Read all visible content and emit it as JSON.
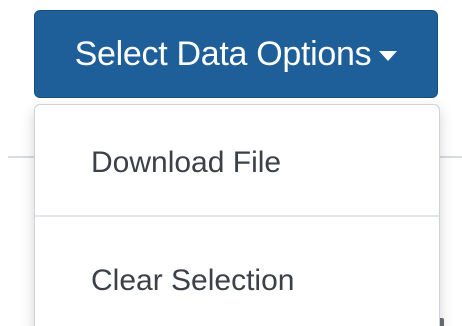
{
  "dropdown": {
    "toggle_label": "Select Data Options",
    "accent_color": "#1f5f99",
    "caret_icon": "caret-down-icon",
    "items": [
      {
        "label": "Download File"
      },
      {
        "label": "Clear Selection"
      }
    ]
  }
}
